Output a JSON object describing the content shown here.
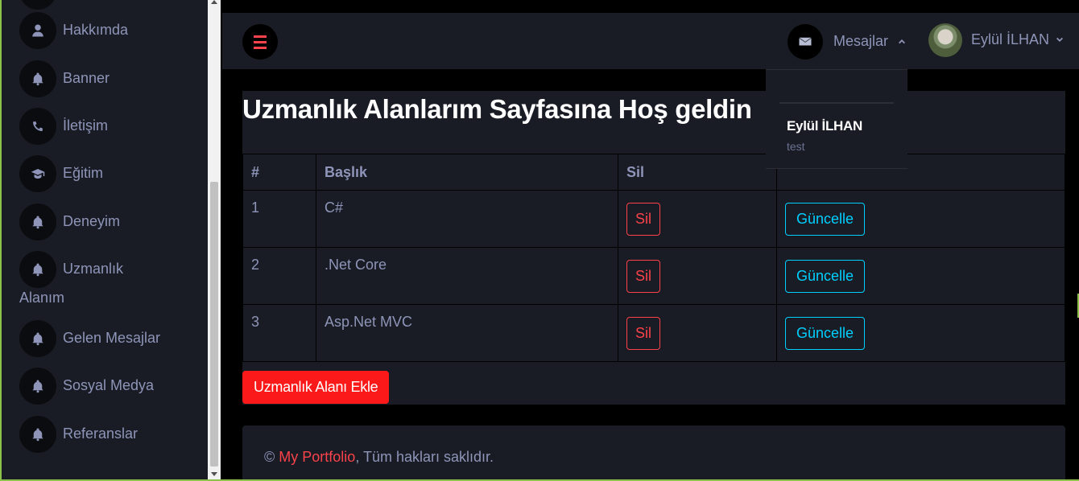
{
  "sidebar": {
    "items": [
      {
        "label": "Hakkımda",
        "icon": "user-icon"
      },
      {
        "label": "Banner",
        "icon": "bell-icon"
      },
      {
        "label": "İletişim",
        "icon": "phone-icon"
      },
      {
        "label": "Eğitim",
        "icon": "graduation-cap-icon"
      },
      {
        "label": "Deneyim",
        "icon": "bell-icon"
      },
      {
        "label": "Uzmanlık",
        "label_line2": "Alanım",
        "icon": "bell-icon"
      },
      {
        "label": "Gelen Mesajlar",
        "icon": "bell-icon"
      },
      {
        "label": "Sosyal Medya",
        "icon": "bell-icon"
      },
      {
        "label": "Referanslar",
        "icon": "bell-icon"
      }
    ]
  },
  "navbar": {
    "messages_label": "Mesajlar",
    "user_name": "Eylül İLHAN"
  },
  "dropdown": {
    "sender": "Eylül İLHAN",
    "preview": "test"
  },
  "main": {
    "title": "Uzmanlık Alanlarım Sayfasına Hoş geldin",
    "columns": [
      "#",
      "Başlık",
      "Sil",
      ""
    ],
    "rows": [
      {
        "id": "1",
        "title": "C#",
        "delete_label": "Sil",
        "update_label": "Güncelle"
      },
      {
        "id": "2",
        "title": ".Net Core",
        "delete_label": "Sil",
        "update_label": "Güncelle"
      },
      {
        "id": "3",
        "title": "Asp.Net MVC",
        "delete_label": "Sil",
        "update_label": "Güncelle"
      }
    ],
    "add_button": "Uzmanlık Alanı Ekle"
  },
  "footer": {
    "copyright": "©",
    "brand": "My Portfolio",
    "rights": ", Tüm hakları saklıdır."
  },
  "colors": {
    "accent_red": "#fc424a",
    "accent_cyan": "#00d0ff",
    "panel": "#191c24"
  }
}
